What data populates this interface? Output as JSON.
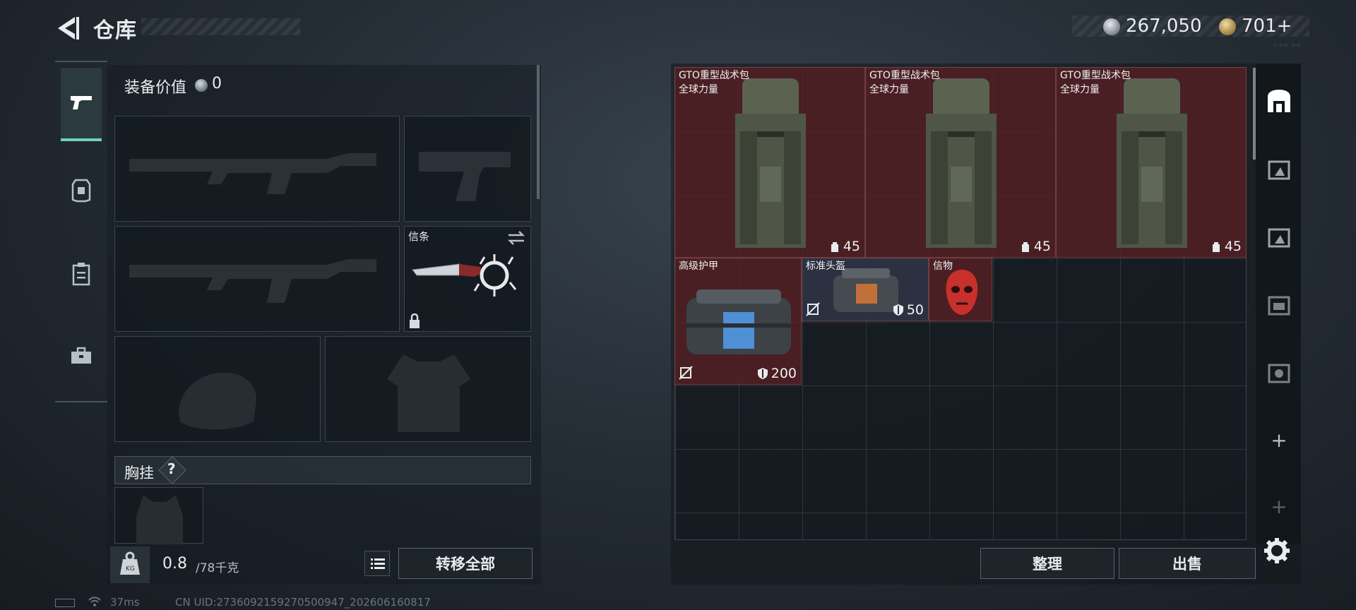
{
  "header": {
    "title": "仓库",
    "currency_silver": "267,050",
    "currency_gold": "701+",
    "mini_text": "⁘⁘⁘ ⁘⁘"
  },
  "loadout": {
    "equip_value_label": "装备价值",
    "equip_value": "0",
    "token_slot_label": "信条",
    "chest_rig_label": "胸挂",
    "chest_rig_help": "?",
    "weight_value": "0.8",
    "weight_capacity": "/78千克",
    "transfer_all_label": "转移全部"
  },
  "storage": {
    "items": [
      {
        "name": "GTO重型战术包",
        "sub": "全球力量",
        "stat": "45"
      },
      {
        "name": "GTO重型战术包",
        "sub": "全球力量",
        "stat": "45"
      },
      {
        "name": "GTO重型战术包",
        "sub": "全球力量",
        "stat": "45"
      },
      {
        "name": "高级护甲",
        "stat": "200"
      },
      {
        "name": "标准头盔",
        "stat": "50"
      },
      {
        "name": "信物"
      }
    ],
    "sort_label": "整理",
    "sell_label": "出售",
    "add_symbol": "+"
  },
  "status": {
    "ping": "37ms",
    "uid": "CN UID:2736092159270500947_202606160817"
  },
  "colors": {
    "accent": "#6fd3b6",
    "item_red": "#58202a",
    "item_navy": "#323448"
  },
  "icons": [
    "back-arrow-icon",
    "silver-coin-icon",
    "gold-coin-icon",
    "pistol-icon",
    "armor-icon",
    "clipboard-icon",
    "toolbox-icon",
    "swap-icon",
    "lock-icon",
    "weight-icon",
    "list-icon",
    "backpack-icon",
    "shield-icon",
    "no-flag-icon",
    "home-icon",
    "container-icon",
    "add-icon",
    "gear-icon",
    "battery-icon",
    "wifi-icon"
  ]
}
